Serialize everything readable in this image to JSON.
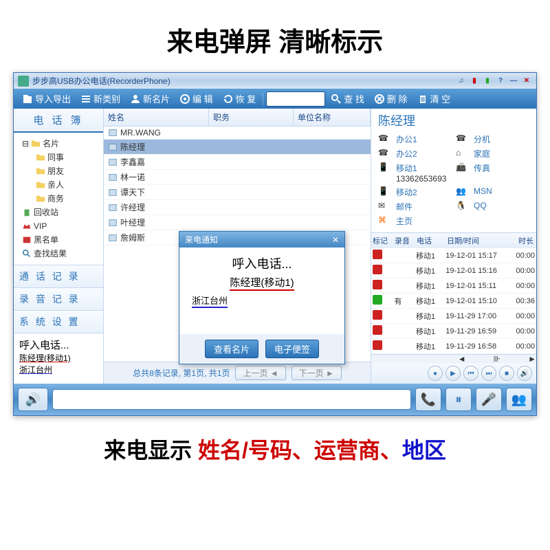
{
  "window": {
    "title": "步步高USB办公电话(RecorderPhone)"
  },
  "toolbar": {
    "import_export": "导入导出",
    "new_category": "新类别",
    "new_card": "新名片",
    "edit": "编 辑",
    "restore": "恢 复",
    "search": "查 找",
    "delete": "删 除",
    "clear": "清 空"
  },
  "left": {
    "phonebook": "电 话 簿",
    "tree": {
      "namecard": "名片",
      "colleague": "同事",
      "friend": "朋友",
      "family": "亲人",
      "business": "商务",
      "recycle": "回收站",
      "vip": "VIP",
      "blacklist": "黑名单",
      "search_result": "查找结果"
    },
    "tabs": {
      "call_log": "通 话 记 录",
      "rec_log": "录 音 记 录",
      "settings": "系 统 设 置"
    },
    "notice": {
      "title": "呼入电话...",
      "name": "陈经理(移动1)",
      "loc": "浙江台州"
    }
  },
  "grid": {
    "col_name": "姓名",
    "col_title": "职务",
    "col_company": "单位名称",
    "rows": [
      {
        "name": "MR.WANG"
      },
      {
        "name": "陈经理"
      },
      {
        "name": "李鑫嘉"
      },
      {
        "name": "林一诺"
      },
      {
        "name": "谭天下"
      },
      {
        "name": "许经理"
      },
      {
        "name": "叶经理"
      },
      {
        "name": "詹姆斯"
      }
    ],
    "footer_summary": "总共8条记录, 第1页, 共1页",
    "prev": "上一页 ◄",
    "next": "下一页 ►"
  },
  "detail": {
    "name": "陈经理",
    "fields": {
      "office1": "办公1",
      "ext": "分机",
      "office2": "办公2",
      "home": "家庭",
      "mobile1": "移动1",
      "mobile1_val": "13362653693",
      "fax": "传真",
      "mobile2": "移动2",
      "msn": "MSN",
      "mail": "邮件",
      "qq": "QQ",
      "homepage": "主页"
    }
  },
  "log": {
    "col_mark": "标记",
    "col_rec": "录音",
    "col_phone": "电话",
    "col_dt": "日期/时间",
    "col_dur": "时长",
    "rows": [
      {
        "mark": "red",
        "rec": "",
        "phone": "移动1",
        "dt": "19-12-01 15:17",
        "dur": "00:00"
      },
      {
        "mark": "red",
        "rec": "",
        "phone": "移动1",
        "dt": "19-12-01 15:16",
        "dur": "00:00"
      },
      {
        "mark": "red",
        "rec": "",
        "phone": "移动1",
        "dt": "19-12-01 15:11",
        "dur": "00:00"
      },
      {
        "mark": "green",
        "rec": "有",
        "phone": "移动1",
        "dt": "19-12-01 15:10",
        "dur": "00:36"
      },
      {
        "mark": "red",
        "rec": "",
        "phone": "移动1",
        "dt": "19-11-29 17:00",
        "dur": "00:00"
      },
      {
        "mark": "red",
        "rec": "",
        "phone": "移动1",
        "dt": "19-11-29 16:59",
        "dur": "00:00"
      },
      {
        "mark": "red",
        "rec": "",
        "phone": "移动1",
        "dt": "19-11-29 16:58",
        "dur": "00:00"
      }
    ]
  },
  "popup": {
    "title": "来电通知",
    "line1": "呼入电话...",
    "line2": "陈经理(移动1)",
    "line3": "浙江台州",
    "btn_view": "查看名片",
    "btn_note": "电子便签"
  },
  "bottom_caption": {
    "part1": "来",
    "part_gap": "    ",
    "name_num": "姓名/号码、运营商、",
    "region": "地区"
  }
}
